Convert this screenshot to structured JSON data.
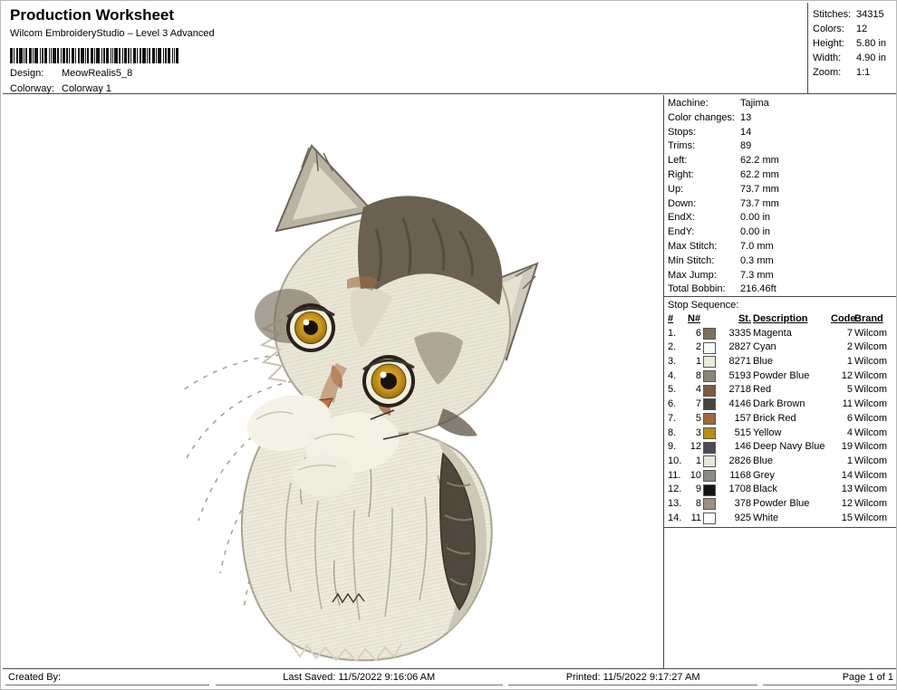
{
  "header": {
    "title": "Production Worksheet",
    "subtitle": "Wilcom EmbroideryStudio – Level 3 Advanced",
    "design_label": "Design:",
    "design_value": "MeowRealis5_8",
    "colorway_label": "Colorway:",
    "colorway_value": "Colorway 1"
  },
  "stats": {
    "rows": [
      {
        "label": "Stitches:",
        "value": "34315"
      },
      {
        "label": "Colors:",
        "value": "12"
      },
      {
        "label": "Height:",
        "value": "5.80 in"
      },
      {
        "label": "Width:",
        "value": "4.90 in"
      },
      {
        "label": "Zoom:",
        "value": "1:1"
      }
    ]
  },
  "machine": {
    "rows": [
      {
        "label": "Machine:",
        "value": "Tajima"
      },
      {
        "label": "Color changes:",
        "value": "13"
      },
      {
        "label": "Stops:",
        "value": "14"
      },
      {
        "label": "Trims:",
        "value": "89"
      },
      {
        "label": "Left:",
        "value": "62.2 mm"
      },
      {
        "label": "Right:",
        "value": "62.2 mm"
      },
      {
        "label": "Up:",
        "value": "73.7 mm"
      },
      {
        "label": "Down:",
        "value": "73.7 mm"
      },
      {
        "label": "EndX:",
        "value": "0.00 in"
      },
      {
        "label": "EndY:",
        "value": "0.00 in"
      },
      {
        "label": "Max Stitch:",
        "value": "7.0 mm"
      },
      {
        "label": "Min Stitch:",
        "value": "0.3 mm"
      },
      {
        "label": "Max Jump:",
        "value": "7.3 mm"
      },
      {
        "label": "Total Bobbin:",
        "value": "216.46ft"
      }
    ]
  },
  "stop_sequence": {
    "title": "Stop Sequence:",
    "columns": [
      "#",
      "N#",
      "St.",
      "Description",
      "Code",
      "Brand"
    ],
    "rows": [
      {
        "num": "1.",
        "n": "6",
        "swatch": "#7d7257",
        "st": "3335",
        "desc": "Magenta",
        "code": "7",
        "brand": "Wilcom"
      },
      {
        "num": "2.",
        "n": "2",
        "swatch": "#f8f8f6",
        "st": "2827",
        "desc": "Cyan",
        "code": "2",
        "brand": "Wilcom"
      },
      {
        "num": "3.",
        "n": "1",
        "swatch": "#e9eada",
        "st": "8271",
        "desc": "Blue",
        "code": "1",
        "brand": "Wilcom"
      },
      {
        "num": "4.",
        "n": "8",
        "swatch": "#8c8678",
        "st": "5193",
        "desc": "Powder Blue",
        "code": "12",
        "brand": "Wilcom"
      },
      {
        "num": "5.",
        "n": "4",
        "swatch": "#7d5c42",
        "st": "2718",
        "desc": "Red",
        "code": "5",
        "brand": "Wilcom"
      },
      {
        "num": "6.",
        "n": "7",
        "swatch": "#4a443e",
        "st": "4146",
        "desc": "Dark Brown",
        "code": "11",
        "brand": "Wilcom"
      },
      {
        "num": "7.",
        "n": "5",
        "swatch": "#a5643c",
        "st": "157",
        "desc": "Brick Red",
        "code": "6",
        "brand": "Wilcom"
      },
      {
        "num": "8.",
        "n": "3",
        "swatch": "#b8900e",
        "st": "515",
        "desc": "Yellow",
        "code": "4",
        "brand": "Wilcom"
      },
      {
        "num": "9.",
        "n": "12",
        "swatch": "#4c4c57",
        "st": "146",
        "desc": "Deep Navy Blue",
        "code": "19",
        "brand": "Wilcom"
      },
      {
        "num": "10.",
        "n": "1",
        "swatch": "#e8e8da",
        "st": "2826",
        "desc": "Blue",
        "code": "1",
        "brand": "Wilcom"
      },
      {
        "num": "11.",
        "n": "10",
        "swatch": "#8a8a86",
        "st": "1168",
        "desc": "Grey",
        "code": "14",
        "brand": "Wilcom"
      },
      {
        "num": "12.",
        "n": "9",
        "swatch": "#141414",
        "st": "1708",
        "desc": "Black",
        "code": "13",
        "brand": "Wilcom"
      },
      {
        "num": "13.",
        "n": "8",
        "swatch": "#9c8f80",
        "st": "378",
        "desc": "Powder Blue",
        "code": "12",
        "brand": "Wilcom"
      },
      {
        "num": "14.",
        "n": "11",
        "swatch": "#ffffff",
        "st": "925",
        "desc": "White",
        "code": "15",
        "brand": "Wilcom"
      }
    ]
  },
  "footer": {
    "created_by": "Created By:",
    "last_saved": "Last Saved: 11/5/2022 9:16:06 AM",
    "printed": "Printed: 11/5/2022 9:17:27 AM",
    "page": "Page 1 of 1"
  },
  "artwork": {
    "subject": "Embroidered tabby kitten with tilted head, amber eyes and fluffy white chest",
    "palette": {
      "cream": "#e9e6d6",
      "taupe": "#b9b3a1",
      "dark_fur": "#6b6150",
      "accent_rust": "#a5643c",
      "eye_amber": "#c9951c",
      "tail_dark": "#4f473c"
    }
  }
}
